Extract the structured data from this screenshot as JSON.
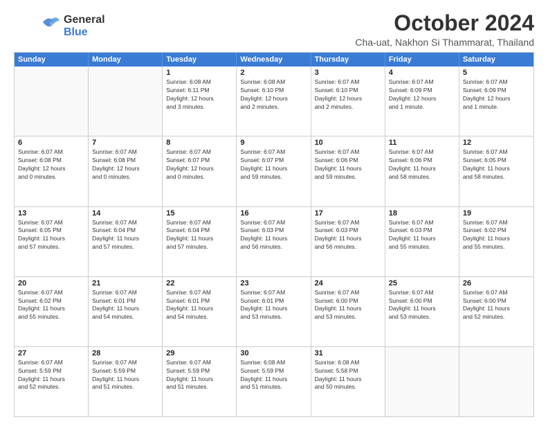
{
  "logo": {
    "line1": "General",
    "line2": "Blue"
  },
  "title": "October 2024",
  "subtitle": "Cha-uat, Nakhon Si Thammarat, Thailand",
  "days_of_week": [
    "Sunday",
    "Monday",
    "Tuesday",
    "Wednesday",
    "Thursday",
    "Friday",
    "Saturday"
  ],
  "weeks": [
    [
      {
        "day": "",
        "info": "",
        "empty": true
      },
      {
        "day": "",
        "info": "",
        "empty": true
      },
      {
        "day": "1",
        "info": "Sunrise: 6:08 AM\nSunset: 6:11 PM\nDaylight: 12 hours\nand 3 minutes."
      },
      {
        "day": "2",
        "info": "Sunrise: 6:08 AM\nSunset: 6:10 PM\nDaylight: 12 hours\nand 2 minutes."
      },
      {
        "day": "3",
        "info": "Sunrise: 6:07 AM\nSunset: 6:10 PM\nDaylight: 12 hours\nand 2 minutes."
      },
      {
        "day": "4",
        "info": "Sunrise: 6:07 AM\nSunset: 6:09 PM\nDaylight: 12 hours\nand 1 minute."
      },
      {
        "day": "5",
        "info": "Sunrise: 6:07 AM\nSunset: 6:09 PM\nDaylight: 12 hours\nand 1 minute."
      }
    ],
    [
      {
        "day": "6",
        "info": "Sunrise: 6:07 AM\nSunset: 6:08 PM\nDaylight: 12 hours\nand 0 minutes."
      },
      {
        "day": "7",
        "info": "Sunrise: 6:07 AM\nSunset: 6:08 PM\nDaylight: 12 hours\nand 0 minutes."
      },
      {
        "day": "8",
        "info": "Sunrise: 6:07 AM\nSunset: 6:07 PM\nDaylight: 12 hours\nand 0 minutes."
      },
      {
        "day": "9",
        "info": "Sunrise: 6:07 AM\nSunset: 6:07 PM\nDaylight: 11 hours\nand 59 minutes."
      },
      {
        "day": "10",
        "info": "Sunrise: 6:07 AM\nSunset: 6:06 PM\nDaylight: 11 hours\nand 59 minutes."
      },
      {
        "day": "11",
        "info": "Sunrise: 6:07 AM\nSunset: 6:06 PM\nDaylight: 11 hours\nand 58 minutes."
      },
      {
        "day": "12",
        "info": "Sunrise: 6:07 AM\nSunset: 6:05 PM\nDaylight: 11 hours\nand 58 minutes."
      }
    ],
    [
      {
        "day": "13",
        "info": "Sunrise: 6:07 AM\nSunset: 6:05 PM\nDaylight: 11 hours\nand 57 minutes."
      },
      {
        "day": "14",
        "info": "Sunrise: 6:07 AM\nSunset: 6:04 PM\nDaylight: 11 hours\nand 57 minutes."
      },
      {
        "day": "15",
        "info": "Sunrise: 6:07 AM\nSunset: 6:04 PM\nDaylight: 11 hours\nand 57 minutes."
      },
      {
        "day": "16",
        "info": "Sunrise: 6:07 AM\nSunset: 6:03 PM\nDaylight: 11 hours\nand 56 minutes."
      },
      {
        "day": "17",
        "info": "Sunrise: 6:07 AM\nSunset: 6:03 PM\nDaylight: 11 hours\nand 56 minutes."
      },
      {
        "day": "18",
        "info": "Sunrise: 6:07 AM\nSunset: 6:03 PM\nDaylight: 11 hours\nand 55 minutes."
      },
      {
        "day": "19",
        "info": "Sunrise: 6:07 AM\nSunset: 6:02 PM\nDaylight: 11 hours\nand 55 minutes."
      }
    ],
    [
      {
        "day": "20",
        "info": "Sunrise: 6:07 AM\nSunset: 6:02 PM\nDaylight: 11 hours\nand 55 minutes."
      },
      {
        "day": "21",
        "info": "Sunrise: 6:07 AM\nSunset: 6:01 PM\nDaylight: 11 hours\nand 54 minutes."
      },
      {
        "day": "22",
        "info": "Sunrise: 6:07 AM\nSunset: 6:01 PM\nDaylight: 11 hours\nand 54 minutes."
      },
      {
        "day": "23",
        "info": "Sunrise: 6:07 AM\nSunset: 6:01 PM\nDaylight: 11 hours\nand 53 minutes."
      },
      {
        "day": "24",
        "info": "Sunrise: 6:07 AM\nSunset: 6:00 PM\nDaylight: 11 hours\nand 53 minutes."
      },
      {
        "day": "25",
        "info": "Sunrise: 6:07 AM\nSunset: 6:00 PM\nDaylight: 11 hours\nand 53 minutes."
      },
      {
        "day": "26",
        "info": "Sunrise: 6:07 AM\nSunset: 6:00 PM\nDaylight: 11 hours\nand 52 minutes."
      }
    ],
    [
      {
        "day": "27",
        "info": "Sunrise: 6:07 AM\nSunset: 5:59 PM\nDaylight: 11 hours\nand 52 minutes."
      },
      {
        "day": "28",
        "info": "Sunrise: 6:07 AM\nSunset: 5:59 PM\nDaylight: 11 hours\nand 51 minutes."
      },
      {
        "day": "29",
        "info": "Sunrise: 6:07 AM\nSunset: 5:59 PM\nDaylight: 11 hours\nand 51 minutes."
      },
      {
        "day": "30",
        "info": "Sunrise: 6:08 AM\nSunset: 5:59 PM\nDaylight: 11 hours\nand 51 minutes."
      },
      {
        "day": "31",
        "info": "Sunrise: 6:08 AM\nSunset: 5:58 PM\nDaylight: 11 hours\nand 50 minutes."
      },
      {
        "day": "",
        "info": "",
        "empty": true
      },
      {
        "day": "",
        "info": "",
        "empty": true
      }
    ]
  ]
}
